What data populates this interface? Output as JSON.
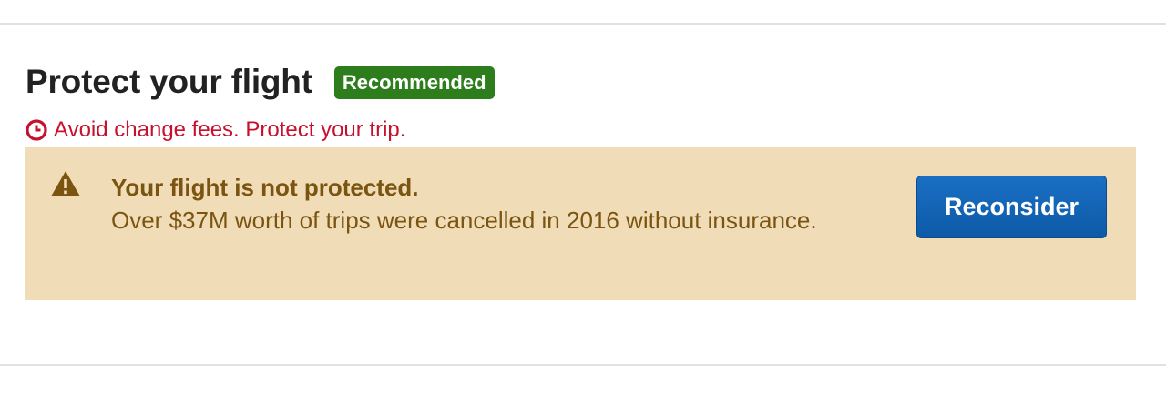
{
  "section": {
    "title": "Protect your flight",
    "badge": "Recommended",
    "urgency_text": "Avoid change fees. Protect your trip.",
    "urgency_icon": "clock-icon"
  },
  "alert": {
    "icon": "warning-icon",
    "title": "Your flight is not protected.",
    "body": "Over $37M worth of trips were cancelled in 2016 without insurance.",
    "button_label": "Reconsider"
  },
  "colors": {
    "title": "#222222",
    "badge_bg": "#2e7d1c",
    "urgency": "#c8102e",
    "alert_bg": "#f0ddb8",
    "alert_text": "#7a5410",
    "button_bg": "#1565b8"
  }
}
